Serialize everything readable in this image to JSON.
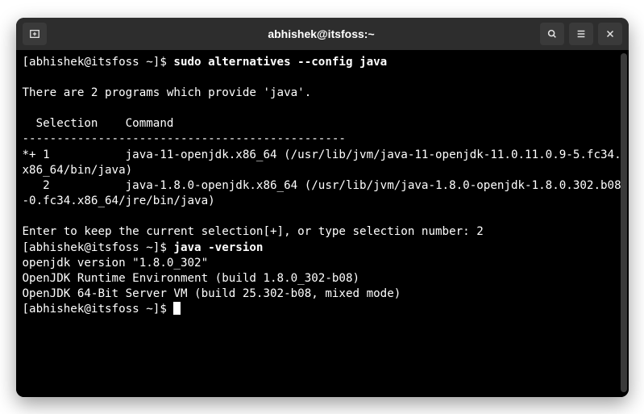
{
  "titlebar": {
    "title": "abhishek@itsfoss:~"
  },
  "terminal": {
    "line1_prompt": "[abhishek@itsfoss ~]$ ",
    "line1_cmd": "sudo alternatives --config java",
    "blank1": "",
    "line2": "There are 2 programs which provide 'java'.",
    "blank2": "",
    "header": "  Selection    Command",
    "divider": "-----------------------------------------------",
    "opt1": "*+ 1           java-11-openjdk.x86_64 (/usr/lib/jvm/java-11-openjdk-11.0.11.0.9-5.fc34.x86_64/bin/java)",
    "opt2": "   2           java-1.8.0-openjdk.x86_64 (/usr/lib/jvm/java-1.8.0-openjdk-1.8.0.302.b08-0.fc34.x86_64/jre/bin/java)",
    "blank3": "",
    "enter": "Enter to keep the current selection[+], or type selection number: 2",
    "line3_prompt": "[abhishek@itsfoss ~]$ ",
    "line3_cmd": "java -version",
    "ver1": "openjdk version \"1.8.0_302\"",
    "ver2": "OpenJDK Runtime Environment (build 1.8.0_302-b08)",
    "ver3": "OpenJDK 64-Bit Server VM (build 25.302-b08, mixed mode)",
    "line4_prompt": "[abhishek@itsfoss ~]$ "
  }
}
